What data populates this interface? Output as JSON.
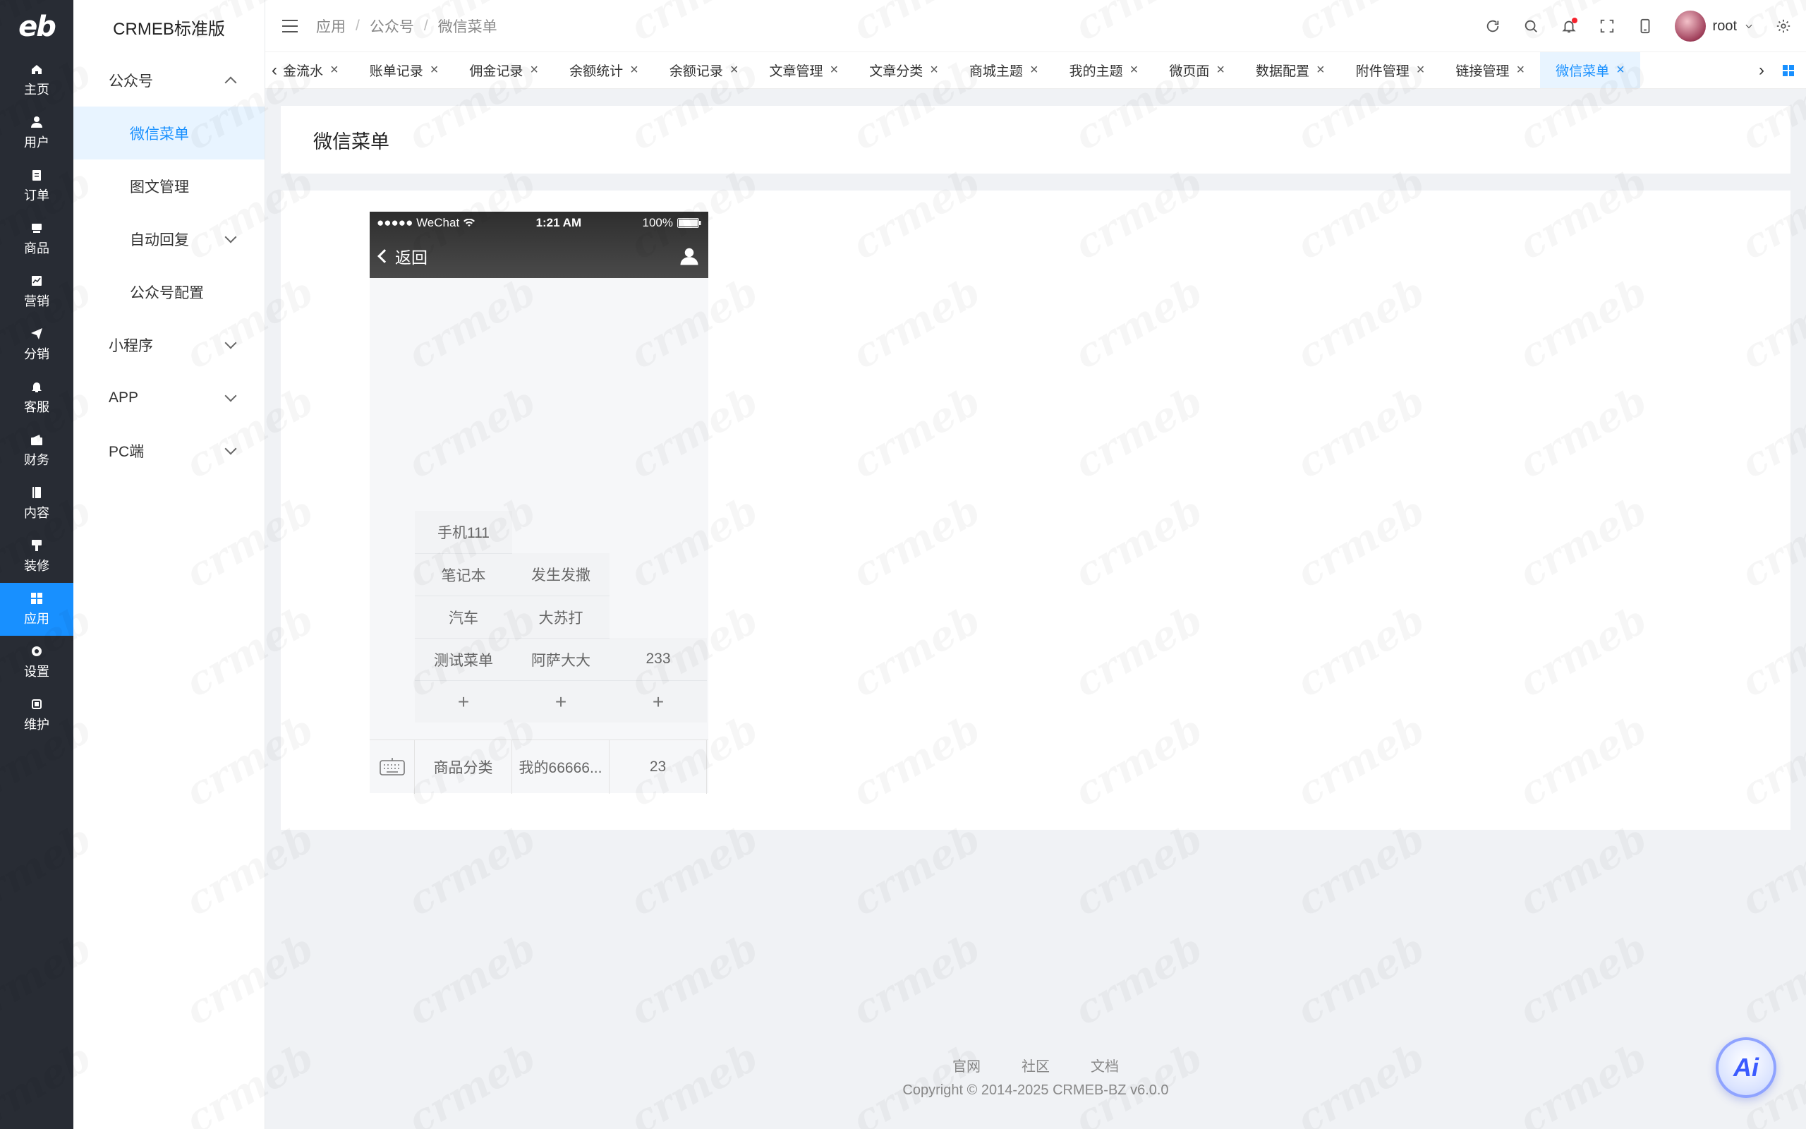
{
  "rail": {
    "logo": "eb",
    "items": [
      {
        "label": "主页",
        "icon": "home-icon"
      },
      {
        "label": "用户",
        "icon": "user-icon"
      },
      {
        "label": "订单",
        "icon": "clipboard-icon"
      },
      {
        "label": "商品",
        "icon": "box-icon"
      },
      {
        "label": "营销",
        "icon": "chart-icon"
      },
      {
        "label": "分销",
        "icon": "send-icon"
      },
      {
        "label": "客服",
        "icon": "bell-icon"
      },
      {
        "label": "财务",
        "icon": "wallet-icon"
      },
      {
        "label": "内容",
        "icon": "book-icon"
      },
      {
        "label": "装修",
        "icon": "brush-icon"
      },
      {
        "label": "应用",
        "icon": "grid-icon"
      },
      {
        "label": "设置",
        "icon": "gear-icon"
      },
      {
        "label": "维护",
        "icon": "chip-icon"
      }
    ],
    "active_index": 10
  },
  "sidebar": {
    "title": "CRMEB标准版",
    "groups": [
      {
        "label": "公众号",
        "expanded": true
      },
      {
        "label": "小程序",
        "expanded": false
      },
      {
        "label": "APP",
        "expanded": false
      },
      {
        "label": "PC端",
        "expanded": false
      }
    ],
    "subitems": [
      {
        "label": "微信菜单",
        "active": true,
        "has_children": false
      },
      {
        "label": "图文管理",
        "active": false,
        "has_children": false
      },
      {
        "label": "自动回复",
        "active": false,
        "has_children": true
      },
      {
        "label": "公众号配置",
        "active": false,
        "has_children": false
      }
    ]
  },
  "header": {
    "breadcrumb": [
      "应用",
      "公众号",
      "微信菜单"
    ],
    "user_name": "root"
  },
  "tabs": {
    "items": [
      "佣金流水",
      "账单记录",
      "佣金记录",
      "余额统计",
      "余额记录",
      "文章管理",
      "文章分类",
      "商城主题",
      "我的主题",
      "微页面",
      "数据配置",
      "附件管理",
      "链接管理",
      "微信菜单"
    ],
    "active_index": 13
  },
  "page": {
    "title": "微信菜单"
  },
  "phone": {
    "carrier": "●●●●● WeChat",
    "time": "1:21 AM",
    "battery": "100%",
    "back_label": "返回",
    "column1_submenu": [
      "手机111",
      "笔记本",
      "汽车",
      "测试菜单"
    ],
    "column2_submenu": [
      "发生发撒",
      "大苏打",
      "阿萨大大"
    ],
    "column3_submenu": [
      "233"
    ],
    "add_symbol": "+",
    "bottom_menu": [
      "商品分类",
      "我的66666...",
      "23"
    ]
  },
  "footer": {
    "links": [
      "官网",
      "社区",
      "文档"
    ],
    "copyright": "Copyright © 2014-2025 CRMEB-BZ v6.0.0"
  },
  "ai_button_label": "Ai",
  "colors": {
    "accent": "#1890ff",
    "rail_bg": "#282c34",
    "active_bg": "#e8f4ff"
  }
}
